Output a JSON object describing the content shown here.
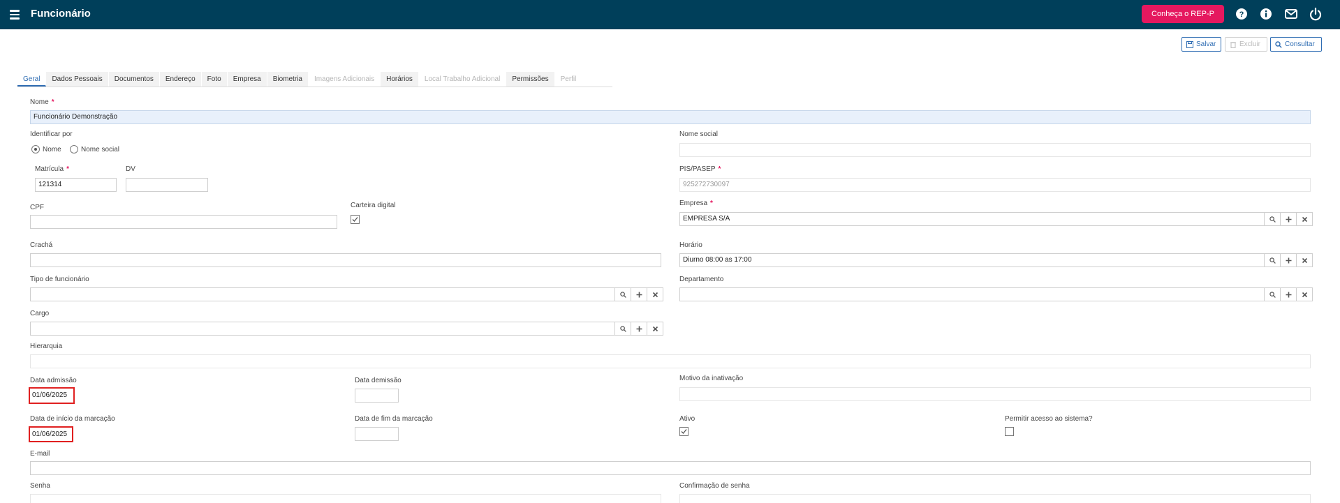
{
  "header": {
    "title": "Funcionário",
    "rep_button": "Conheça o REP-P",
    "icons": [
      "menu-icon",
      "help-icon",
      "info-icon",
      "mail-icon",
      "power-icon"
    ]
  },
  "actions": {
    "save": "Salvar",
    "delete": "Excluir",
    "consult": "Consultar"
  },
  "tabs": [
    {
      "label": "Geral",
      "state": "active"
    },
    {
      "label": "Dados Pessoais",
      "state": "normal"
    },
    {
      "label": "Documentos",
      "state": "normal"
    },
    {
      "label": "Endereço",
      "state": "normal"
    },
    {
      "label": "Foto",
      "state": "normal"
    },
    {
      "label": "Empresa",
      "state": "normal"
    },
    {
      "label": "Biometria",
      "state": "normal"
    },
    {
      "label": "Imagens Adicionais",
      "state": "disabled"
    },
    {
      "label": "Horários",
      "state": "normal"
    },
    {
      "label": "Local Trabalho Adicional",
      "state": "disabled"
    },
    {
      "label": "Permissões",
      "state": "normal"
    },
    {
      "label": "Perfil",
      "state": "disabled"
    }
  ],
  "form": {
    "nome": {
      "label": "Nome",
      "value": "Funcionário Demonstração"
    },
    "identificar_por": {
      "label": "Identificar por",
      "options": [
        "Nome",
        "Nome social"
      ],
      "selected": "Nome"
    },
    "nome_social": {
      "label": "Nome social",
      "value": ""
    },
    "matricula": {
      "label": "Matrícula",
      "value": "121314"
    },
    "dv": {
      "label": "DV",
      "value": ""
    },
    "pis": {
      "label": "PIS/PASEP",
      "value": "925272730097"
    },
    "cpf": {
      "label": "CPF",
      "value": ""
    },
    "carteira_digital": {
      "label": "Carteira digital",
      "checked": true
    },
    "empresa": {
      "label": "Empresa",
      "value": "EMPRESA S/A"
    },
    "cracha": {
      "label": "Crachá",
      "value": ""
    },
    "horario": {
      "label": "Horário",
      "value": "Diurno 08:00 as 17:00"
    },
    "tipo_funcionario": {
      "label": "Tipo de funcionário",
      "value": ""
    },
    "departamento": {
      "label": "Departamento",
      "value": ""
    },
    "cargo": {
      "label": "Cargo",
      "value": ""
    },
    "hierarquia": {
      "label": "Hierarquia",
      "value": ""
    },
    "data_admissao": {
      "label": "Data admissão",
      "value": "01/06/2025"
    },
    "data_demissao": {
      "label": "Data demissão",
      "value": ""
    },
    "motivo_inativacao": {
      "label": "Motivo da inativação",
      "value": ""
    },
    "data_inicio_marcacao": {
      "label": "Data de início da marcação",
      "value": "01/06/2025"
    },
    "data_fim_marcacao": {
      "label": "Data de fim da marcação",
      "value": ""
    },
    "ativo": {
      "label": "Ativo",
      "checked": true
    },
    "permitir_acesso": {
      "label": "Permitir acesso ao sistema?",
      "checked": false
    },
    "email": {
      "label": "E-mail",
      "value": ""
    },
    "senha": {
      "label": "Senha",
      "value": ""
    },
    "confirmacao_senha": {
      "label": "Confirmação de senha",
      "value": ""
    }
  },
  "colors": {
    "topbar": "#003f5a",
    "accent": "#2f6db3",
    "rep_button": "#e5185f",
    "highlight": "#e02020"
  }
}
